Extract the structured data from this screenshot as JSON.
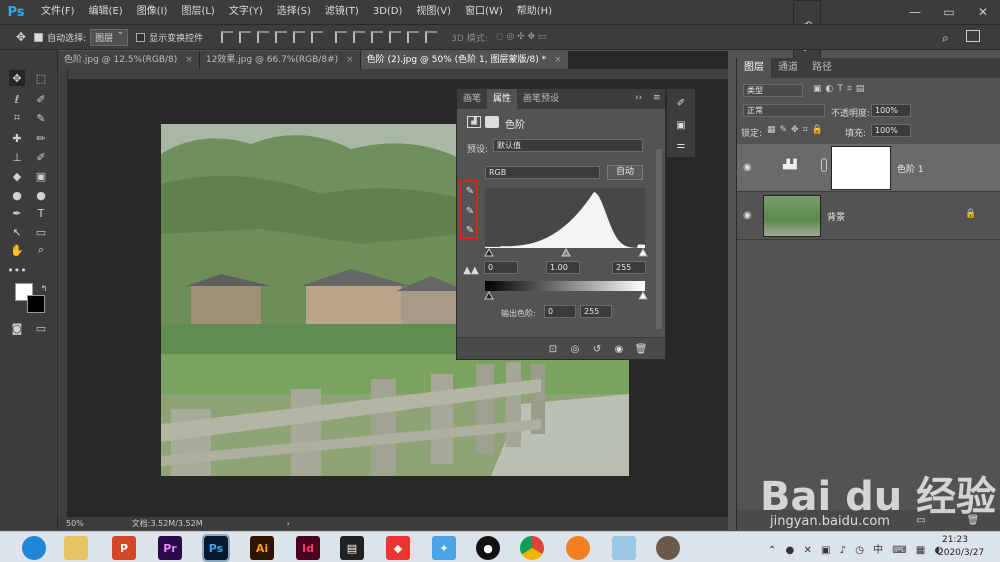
{
  "app": {
    "logo": "Ps"
  },
  "menu": [
    "文件(F)",
    "编辑(E)",
    "图像(I)",
    "图层(L)",
    "文字(Y)",
    "选择(S)",
    "滤镜(T)",
    "3D(D)",
    "视图(V)",
    "窗口(W)",
    "帮助(H)"
  ],
  "options": {
    "auto_select_label": "自动选择:",
    "auto_select_value": "图层",
    "show_transform_label": "显示变换控件",
    "mode_3d_label": "3D 模式:"
  },
  "tabs": [
    {
      "label": "色阶.jpg @ 12.5%(RGB/8)",
      "close": "×"
    },
    {
      "label": "12效果.jpg @ 66.7%(RGB/8#)",
      "close": "×"
    },
    {
      "label": "色阶 (2).jpg @ 50% (色阶 1, 图层蒙版/8) *",
      "close": "×"
    }
  ],
  "status": {
    "zoom": "50%",
    "doc": "文档:3.52M/3.52M"
  },
  "properties": {
    "tabs": [
      "画笔",
      "属性",
      "画笔预设"
    ],
    "title": "色阶",
    "preset_label": "预设:",
    "preset_value": "默认值",
    "channel": "RGB",
    "auto_label": "自动",
    "input_black": "0",
    "input_gamma": "1.00",
    "input_white": "255",
    "output_label": "输出色阶:",
    "output_black": "0",
    "output_white": "255"
  },
  "layers_panel": {
    "tabs": [
      "图层",
      "通道",
      "路径"
    ],
    "filter_label": "类型",
    "blend_mode": "正常",
    "opacity_label": "不透明度:",
    "opacity_value": "100%",
    "lock_label": "锁定:",
    "fill_label": "填充:",
    "fill_value": "100%",
    "layers": [
      {
        "name": "色阶 1"
      },
      {
        "name": "背景"
      }
    ]
  },
  "watermark": {
    "brand": "Bai du 经验",
    "url": "jingyan.baidu.com"
  },
  "taskbar": {
    "time": "21:23",
    "date": "2020/3/27",
    "apps": [
      "Pr",
      "Ps",
      "Ai",
      "Id"
    ]
  },
  "colors": {
    "accent": "#31a8ff",
    "highlight_box": "#e0201b"
  }
}
